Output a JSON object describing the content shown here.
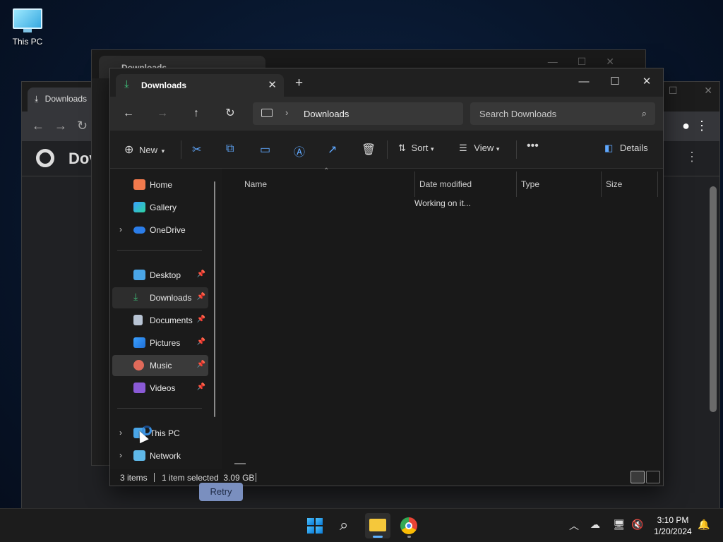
{
  "desktop": {
    "icon_label": "This PC"
  },
  "bg_chrome": {
    "tab_title": "Downloads",
    "page_title": "Dov",
    "retry_label": "Retry",
    "footer_fragment": "3 i"
  },
  "bg_explorer": {
    "tab_title": "Downloads"
  },
  "explorer": {
    "tab_title": "Downloads",
    "address": {
      "location": "Downloads"
    },
    "search": {
      "placeholder": "Search Downloads"
    },
    "commands": {
      "new": "New",
      "sort": "Sort",
      "view": "View",
      "details": "Details"
    },
    "nav": {
      "home": "Home",
      "gallery": "Gallery",
      "onedrive": "OneDrive",
      "desktop": "Desktop",
      "downloads": "Downloads",
      "documents": "Documents",
      "pictures": "Pictures",
      "music": "Music",
      "videos": "Videos",
      "thispc": "This PC",
      "network": "Network"
    },
    "columns": {
      "name": "Name",
      "date": "Date modified",
      "type": "Type",
      "size": "Size"
    },
    "loading_text": "Working on it...",
    "status": {
      "count": "3 items",
      "selection": "1 item selected  3.09 GB"
    }
  },
  "taskbar": {
    "time": "3:10 PM",
    "date": "1/20/2024"
  },
  "colors": {
    "accent": "#5fb2ff",
    "download_green": "#3fc07a",
    "window_bg": "#191919"
  }
}
